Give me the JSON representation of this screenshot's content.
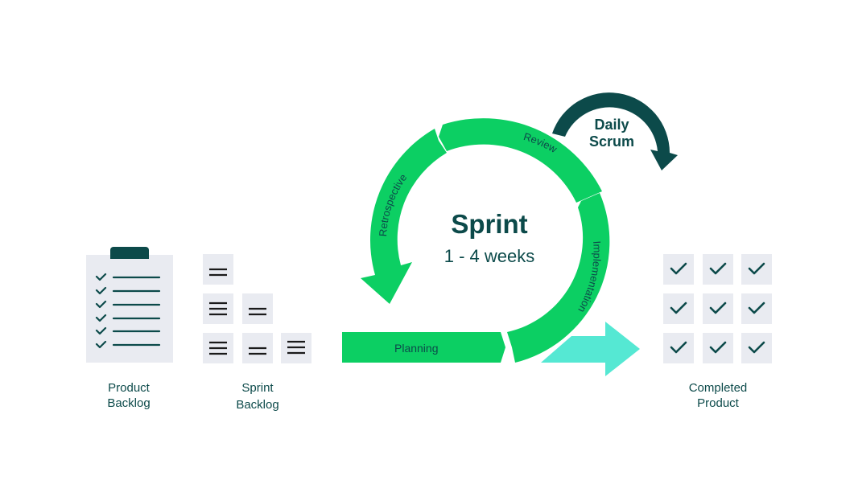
{
  "colors": {
    "dark_teal": "#0c4a4a",
    "green": "#0ccf63",
    "aqua": "#55e8d3",
    "tile": "#e9ebf1"
  },
  "product_backlog": {
    "label_line1": "Product",
    "label_line2": "Backlog",
    "checked_items": 6
  },
  "sprint_backlog": {
    "label_line1": "Sprint",
    "label_line2": "Backlog"
  },
  "sprint": {
    "title": "Sprint",
    "duration": "1 - 4 weeks",
    "phases": {
      "planning": "Planning",
      "implementation": "Implementation",
      "review": "Review",
      "retrospective": "Retrospective"
    }
  },
  "daily_scrum": {
    "line1": "Daily",
    "line2": "Scrum"
  },
  "completed_product": {
    "label_line1": "Completed",
    "label_line2": "Product",
    "items": 9
  }
}
